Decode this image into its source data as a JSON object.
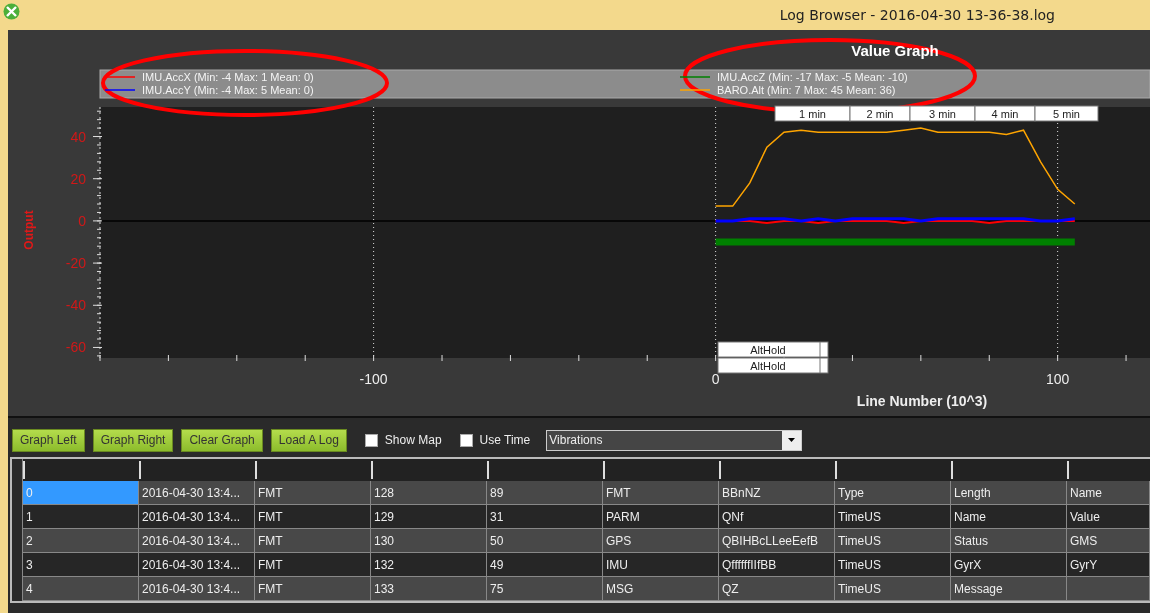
{
  "window": {
    "title": "Log Browser - 2016-04-30 13-36-38.log"
  },
  "graph": {
    "legend": [
      {
        "stats": "(Min: -4 Max: 1 Mean: 0)"
      },
      {
        "stats": "(Min: -4 Max: 5 Mean: 0)"
      },
      {
        "stats": "(Min: -17 Max: -5 Mean: -10)"
      },
      {
        "stats": "(Min: 7 Max: 45 Mean: 36)"
      }
    ],
    "time_markers": [
      "1 min",
      "2 min",
      "3 min",
      "4 min",
      "5 min"
    ],
    "mode_labels": [
      "AltHold",
      "AltHold"
    ],
    "chart_data": {
      "type": "line",
      "title": "Value Graph",
      "xlabel": "Line Number (10^3)",
      "ylabel": "Output",
      "x": [
        0,
        5,
        10,
        15,
        20,
        25,
        30,
        35,
        40,
        45,
        50,
        55,
        60,
        65,
        70,
        75,
        80,
        85,
        90,
        95,
        100,
        105
      ],
      "series": [
        {
          "name": "IMU.AccX",
          "color": "#ff0000",
          "values": [
            0,
            0,
            0,
            -1,
            0,
            0,
            -1,
            0,
            0,
            0,
            0,
            -1,
            0,
            0,
            0,
            0,
            -1,
            0,
            0,
            0,
            0,
            0
          ]
        },
        {
          "name": "IMU.AccY",
          "color": "#0000ff",
          "values": [
            0,
            0,
            1,
            1,
            1,
            0,
            1,
            0,
            1,
            1,
            1,
            1,
            0,
            1,
            1,
            1,
            1,
            1,
            1,
            0,
            0,
            1
          ]
        },
        {
          "name": "IMU.AccZ",
          "color": "#008000",
          "values": [
            -10,
            -10,
            -10,
            -10,
            -10,
            -10,
            -10,
            -10,
            -10,
            -10,
            -10,
            -10,
            -10,
            -10,
            -10,
            -10,
            -10,
            -10,
            -10,
            -10,
            -10,
            -10
          ]
        },
        {
          "name": "BARO.Alt",
          "color": "#ffa500",
          "values": [
            7,
            7,
            18,
            35,
            42,
            43,
            42,
            42,
            42,
            42,
            42,
            43,
            44,
            42,
            42,
            42,
            42,
            41,
            43,
            28,
            15,
            8
          ]
        }
      ],
      "grid": true,
      "xlim": [
        -180,
        127
      ],
      "ylim": [
        -65,
        54
      ],
      "xticks": [
        -100,
        0,
        100
      ],
      "yticks": [
        40,
        20,
        0,
        -20,
        -40,
        -60
      ]
    }
  },
  "marks": [
    {
      "kind": "ellipse"
    },
    {
      "kind": "ellipse"
    }
  ],
  "toolbar": {
    "buttons": [
      "Graph Left",
      "Graph Right",
      "Clear Graph",
      "Load A Log"
    ],
    "checkboxes": [
      {
        "label": "Show Map",
        "checked": false
      },
      {
        "label": "Use Time",
        "checked": false
      }
    ],
    "dropdown": {
      "value": "Vibrations"
    }
  },
  "table": {
    "rows": [
      {
        "selected": true,
        "cells": [
          "0",
          "2016-04-30 13:4...",
          "FMT",
          "128",
          "89",
          "FMT",
          "BBnNZ",
          "Type",
          "Length",
          "Name"
        ]
      },
      {
        "selected": false,
        "cells": [
          "1",
          "2016-04-30 13:4...",
          "FMT",
          "129",
          "31",
          "PARM",
          "QNf",
          "TimeUS",
          "Name",
          "Value"
        ]
      },
      {
        "selected": false,
        "cells": [
          "2",
          "2016-04-30 13:4...",
          "FMT",
          "130",
          "50",
          "GPS",
          "QBIHBcLLeeEefB",
          "TimeUS",
          "Status",
          "GMS"
        ]
      },
      {
        "selected": false,
        "cells": [
          "3",
          "2016-04-30 13:4...",
          "FMT",
          "132",
          "49",
          "IMU",
          "QffffffIIfBB",
          "TimeUS",
          "GyrX",
          "GyrY"
        ]
      },
      {
        "selected": false,
        "cells": [
          "4",
          "2016-04-30 13:4...",
          "FMT",
          "133",
          "75",
          "MSG",
          "QZ",
          "TimeUS",
          "Message",
          ""
        ]
      }
    ]
  }
}
